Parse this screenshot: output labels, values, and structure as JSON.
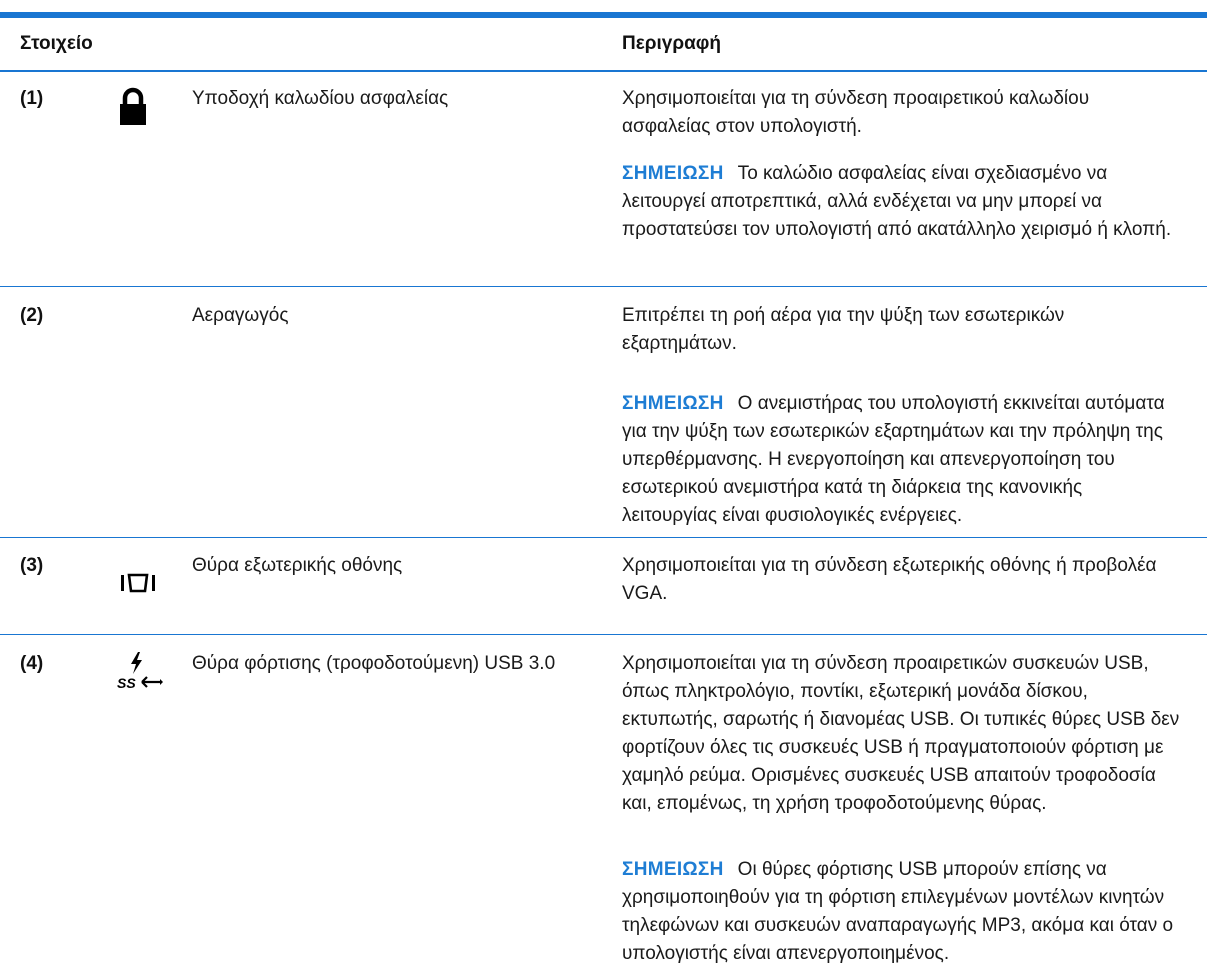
{
  "header": {
    "col_item": "Στοιχείο",
    "col_desc": "Περιγραφή"
  },
  "rows": [
    {
      "number": "(1)",
      "icon": "padlock-icon",
      "label": "Υποδοχή καλωδίου ασφαλείας",
      "description": "Χρησιμοποιείται για τη σύνδεση προαιρετικού καλωδίου ασφαλείας στον υπολογιστή.",
      "note_tag": "ΣΗΜΕΙΩΣΗ",
      "note": "Το καλώδιο ασφαλείας είναι σχεδιασμένο να λειτουργεί αποτρεπτικά, αλλά ενδέχεται να μην μπορεί να προστατεύσει τον υπολογιστή από ακατάλληλο χειρισμό ή κλοπή."
    },
    {
      "number": "(2)",
      "icon": "",
      "label": "Αεραγωγός",
      "description": "Επιτρέπει τη ροή αέρα για την ψύξη των εσωτερικών εξαρτημάτων.",
      "note_tag": "ΣΗΜΕΙΩΣΗ",
      "note": "Ο ανεμιστήρας του υπολογιστή εκκινείται αυτόματα για την ψύξη των εσωτερικών εξαρτημάτων και την πρόληψη της υπερθέρμανσης. Η ενεργοποίηση και απενεργοποίηση του εσωτερικού ανεμιστήρα κατά τη διάρκεια της κανονικής λειτουργίας είναι φυσιολογικές ενέργειες."
    },
    {
      "number": "(3)",
      "icon": "external-monitor-port-icon",
      "label": "Θύρα εξωτερικής οθόνης",
      "description": "Χρησιμοποιείται για τη σύνδεση εξωτερικής οθόνης ή προβολέα VGA."
    },
    {
      "number": "(4)",
      "icon": "usb3-charging-port-icon",
      "icon_text": "SS",
      "label": "Θύρα φόρτισης (τροφοδοτούμενη) USB 3.0",
      "description": "Χρησιμοποιείται για τη σύνδεση προαιρετικών συσκευών USB, όπως πληκτρολόγιο, ποντίκι, εξωτερική μονάδα δίσκου, εκτυπωτής, σαρωτής ή διανομέας USB. Οι τυπικές θύρες USB δεν φορτίζουν όλες τις συσκευές USB ή πραγματοποιούν φόρτιση με χαμηλό ρεύμα. Ορισμένες συσκευές USB απαιτούν τροφοδοσία και, επομένως, τη χρήση τροφοδοτούμενης θύρας.",
      "note_tag": "ΣΗΜΕΙΩΣΗ",
      "note": "Οι θύρες φόρτισης USB μπορούν επίσης να χρησιμοποιηθούν για τη φόρτιση επιλεγμένων μοντέλων κινητών τηλεφώνων και συσκευών αναπαραγωγής MP3, ακόμα και όταν ο υπολογιστής είναι απενεργοποιημένος."
    }
  ],
  "colors": {
    "rule": "#1976d2",
    "note_tag": "#1e7dd4"
  }
}
